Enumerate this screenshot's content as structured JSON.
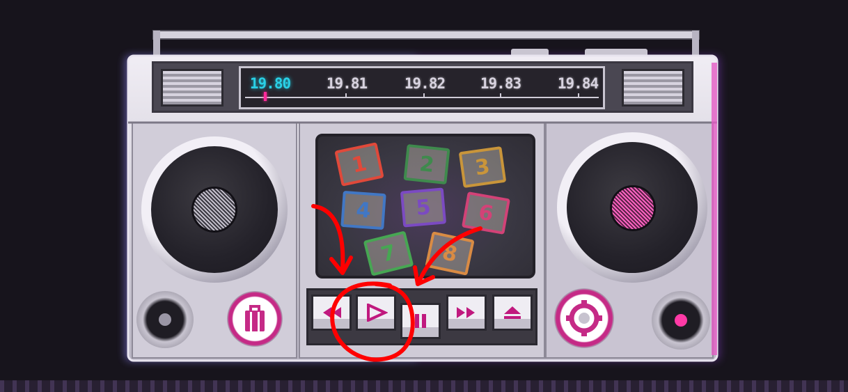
{
  "radio": {
    "frequencies": [
      "19.80",
      "19.81",
      "19.82",
      "19.83",
      "19.84"
    ],
    "selected_frequency": "19.80"
  },
  "blocks": [
    {
      "label": "1",
      "color": "#e0493a"
    },
    {
      "label": "2",
      "color": "#3f8a4d"
    },
    {
      "label": "3",
      "color": "#c9953a"
    },
    {
      "label": "4",
      "color": "#4177c4"
    },
    {
      "label": "5",
      "color": "#7b4ac2"
    },
    {
      "label": "6",
      "color": "#d24277"
    },
    {
      "label": "7",
      "color": "#47a653"
    },
    {
      "label": "8",
      "color": "#d98b44"
    }
  ],
  "transport": {
    "buttons": [
      "rewind-icon",
      "play-icon",
      "pause-icon",
      "fast-forward-icon",
      "eject-icon"
    ],
    "pressed": "pause-icon"
  },
  "annotations": {
    "highlighted_control": "play-icon",
    "color": "#ff0000"
  },
  "colors": {
    "accent_cyan": "#2ad0e6",
    "accent_pink": "#ff2a9a",
    "body": "#d6d3dd",
    "transport_icon": "#c0197e"
  }
}
